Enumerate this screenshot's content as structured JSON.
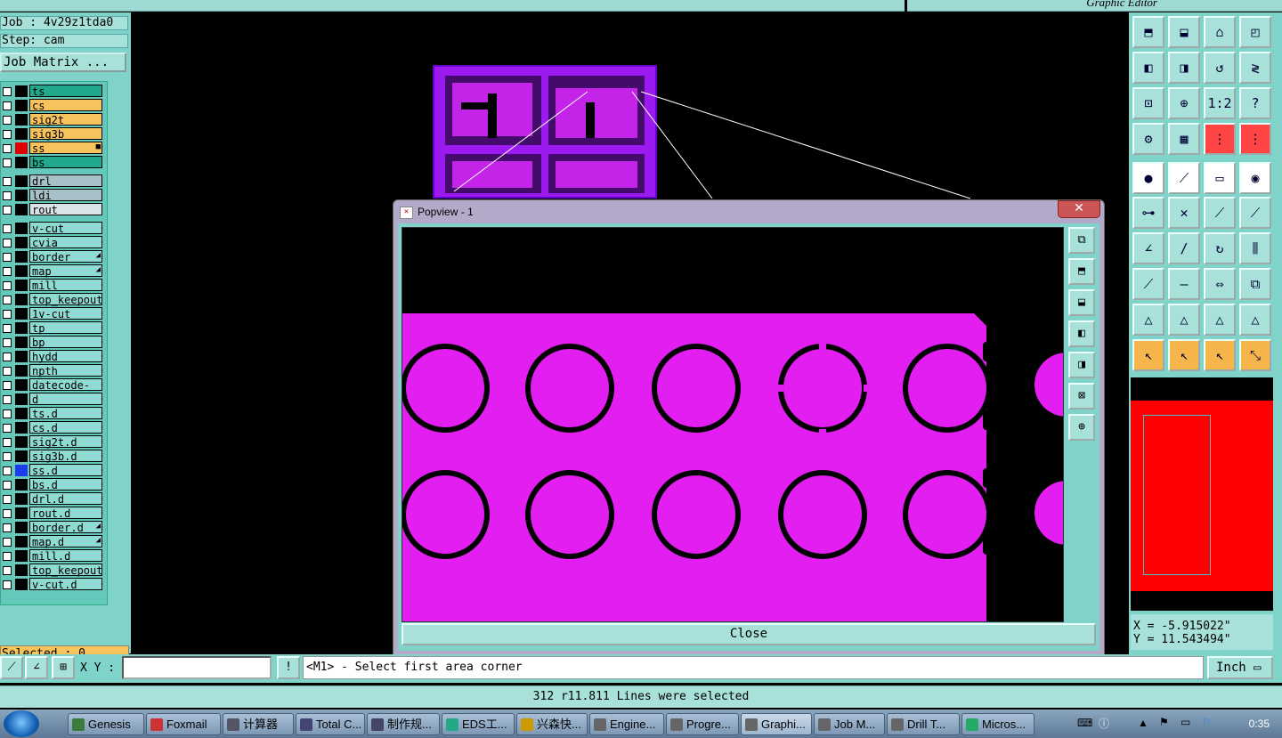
{
  "window": {
    "editor_title": "Graphic Editor"
  },
  "left": {
    "job": "Job : 4v29z1tda0",
    "step": "Step: cam",
    "job_matrix": "Job Matrix ...",
    "selected": "Selected : 0",
    "layers": [
      {
        "name": "ts",
        "bg": "#22a88a",
        "color": "#000"
      },
      {
        "name": "cs",
        "bg": "#f7c35c",
        "color": "#000"
      },
      {
        "name": "sig2t",
        "bg": "#f7c35c",
        "color": "#000"
      },
      {
        "name": "sig3b",
        "bg": "#f7c35c",
        "color": "#000"
      },
      {
        "name": "ss",
        "bg": "#f7c35c",
        "color": "#e00000",
        "mark": "■"
      },
      {
        "name": "bs",
        "bg": "#22a88a",
        "color": "#000"
      },
      {
        "name": "drl",
        "bg": "#a8c0c8",
        "color": "#000"
      },
      {
        "name": "ldi",
        "bg": "#a8c0c8",
        "color": "#000"
      },
      {
        "name": "rout",
        "bg": "#d8e4e8",
        "color": "#000"
      },
      {
        "name": "v-cut",
        "bg": "#8fdad2",
        "color": "#000"
      },
      {
        "name": "cvia",
        "bg": "#8fdad2",
        "color": "#000"
      },
      {
        "name": "border",
        "bg": "#8fdad2",
        "color": "#000",
        "mark": "◢"
      },
      {
        "name": "map",
        "bg": "#8fdad2",
        "color": "#000",
        "mark": "◢"
      },
      {
        "name": "mill",
        "bg": "#8fdad2",
        "color": "#000"
      },
      {
        "name": "top_keepout",
        "bg": "#8fdad2",
        "color": "#000"
      },
      {
        "name": "1v-cut",
        "bg": "#8fdad2",
        "color": "#000"
      },
      {
        "name": "tp",
        "bg": "#8fdad2",
        "color": "#000"
      },
      {
        "name": "bp",
        "bg": "#8fdad2",
        "color": "#000"
      },
      {
        "name": "hydd",
        "bg": "#8fdad2",
        "color": "#000"
      },
      {
        "name": "npth",
        "bg": "#8fdad2",
        "color": "#000"
      },
      {
        "name": "datecode-ts",
        "bg": "#8fdad2",
        "color": "#000"
      },
      {
        "name": "d",
        "bg": "#8fdad2",
        "color": "#000"
      },
      {
        "name": "ts.d",
        "bg": "#8fdad2",
        "color": "#000"
      },
      {
        "name": "cs.d",
        "bg": "#8fdad2",
        "color": "#000"
      },
      {
        "name": "sig2t.d",
        "bg": "#8fdad2",
        "color": "#000"
      },
      {
        "name": "sig3b.d",
        "bg": "#8fdad2",
        "color": "#000"
      },
      {
        "name": "ss.d",
        "bg": "#8fdad2",
        "color": "#1d3cf0"
      },
      {
        "name": "bs.d",
        "bg": "#8fdad2",
        "color": "#000"
      },
      {
        "name": "drl.d",
        "bg": "#8fdad2",
        "color": "#000"
      },
      {
        "name": "rout.d",
        "bg": "#8fdad2",
        "color": "#000"
      },
      {
        "name": "border.d",
        "bg": "#8fdad2",
        "color": "#000",
        "mark": "◢"
      },
      {
        "name": "map.d",
        "bg": "#8fdad2",
        "color": "#000",
        "mark": "◢"
      },
      {
        "name": "mill.d",
        "bg": "#8fdad2",
        "color": "#000"
      },
      {
        "name": "top_keepout",
        "bg": "#8fdad2",
        "color": "#000"
      },
      {
        "name": "v-cut.d",
        "bg": "#8fdad2",
        "color": "#000"
      }
    ]
  },
  "popview": {
    "title": "Popview - 1",
    "close_x": "✕",
    "close_label": "Close"
  },
  "right": {
    "coord_x": "X = -5.915022\"",
    "coord_y": "Y = 11.543494\"",
    "ratio_label": "1:2"
  },
  "command": {
    "xy_label": "X Y :",
    "xy_value": "",
    "warn": "!",
    "prompt": "<M1> - Select first area corner",
    "units": "Inch"
  },
  "status": "312 r11.811 Lines were selected",
  "taskbar": {
    "items": [
      "Genesis",
      "Foxmail",
      "计算器",
      "Total C...",
      "制作规...",
      "EDS工...",
      "兴森快...",
      "Engine...",
      "Progre...",
      "Graphi...",
      "Job M...",
      "Drill T...",
      "Micros..."
    ],
    "clock": "0:35"
  },
  "colors": {
    "accent": "#7fd3c8",
    "copper": "#e21ef0",
    "board": "#9a1af0"
  }
}
